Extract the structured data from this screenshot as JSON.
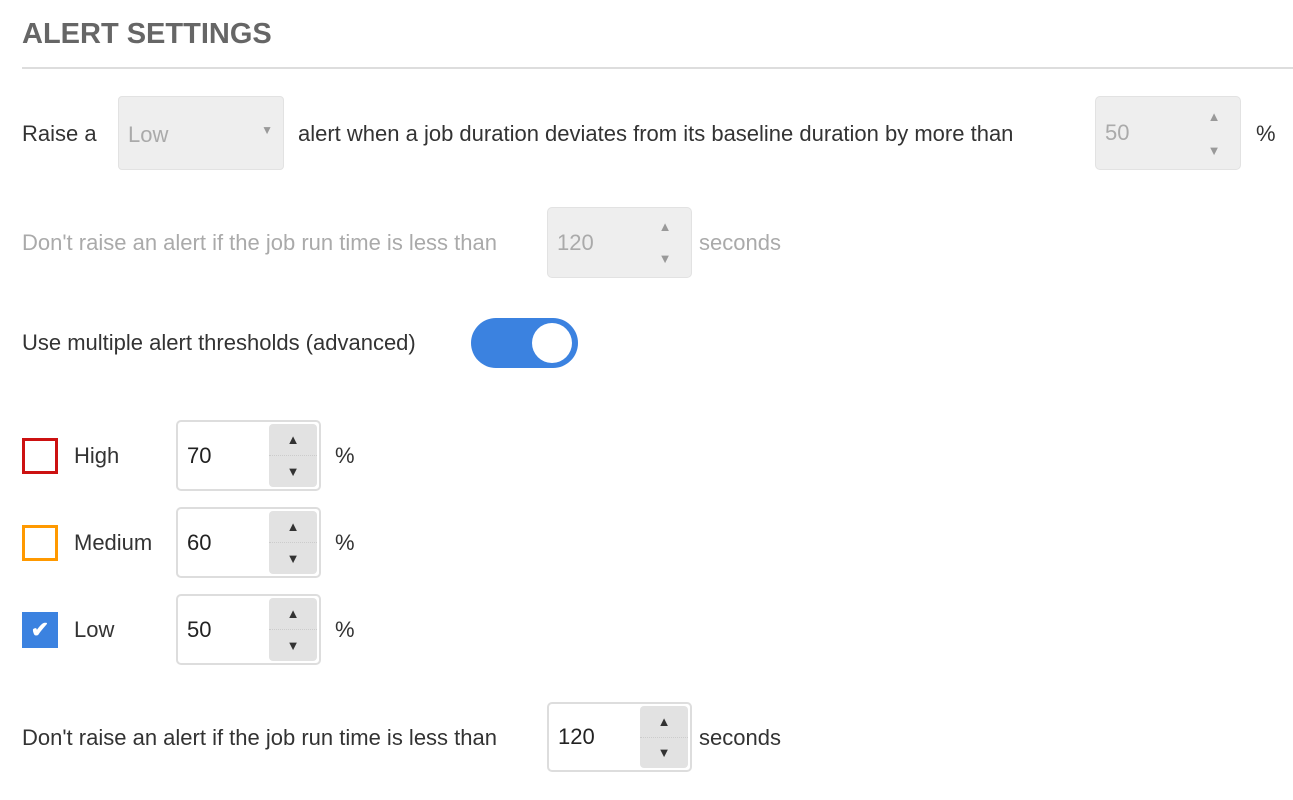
{
  "title": "ALERT SETTINGS",
  "single": {
    "prefix": "Raise a",
    "severity_selected": "Low",
    "middle": "alert when a job duration deviates from its baseline duration by more than",
    "percent_value": "50",
    "percent_unit": "%",
    "min_runtime_prefix": "Don't raise an alert if the job run time is less than",
    "min_runtime_value": "120",
    "min_runtime_unit": "seconds"
  },
  "toggle": {
    "label": "Use multiple alert thresholds (advanced)",
    "on": true,
    "color": "#3b82e0"
  },
  "thresholds": [
    {
      "label": "High",
      "value": "70",
      "unit": "%",
      "checked": false,
      "color": "#cc1111"
    },
    {
      "label": "Medium",
      "value": "60",
      "unit": "%",
      "checked": false,
      "color": "#ff9900"
    },
    {
      "label": "Low",
      "value": "50",
      "unit": "%",
      "checked": true,
      "color": "#3b82e0"
    }
  ],
  "multi": {
    "min_runtime_prefix": "Don't raise an alert if the job run time is less than",
    "min_runtime_value": "120",
    "min_runtime_unit": "seconds"
  },
  "icons": {
    "up": "▲",
    "down": "▼",
    "check": "✔",
    "dropdown": "▼"
  }
}
